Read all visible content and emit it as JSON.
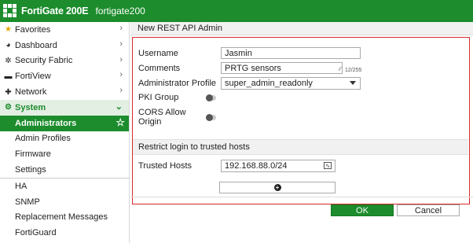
{
  "topbar": {
    "brand": "FortiGate 200E",
    "hostname": "fortigate200"
  },
  "sidebar": {
    "items": [
      {
        "label": "Favorites",
        "icon": "star-icon"
      },
      {
        "label": "Dashboard",
        "icon": "dashboard-icon"
      },
      {
        "label": "Security Fabric",
        "icon": "fabric-icon"
      },
      {
        "label": "FortiView",
        "icon": "fortiview-icon"
      },
      {
        "label": "Network",
        "icon": "network-icon"
      },
      {
        "label": "System",
        "icon": "gear-icon"
      }
    ],
    "system_children": [
      "Administrators",
      "Admin Profiles",
      "Firmware",
      "Settings",
      "HA",
      "SNMP",
      "Replacement Messages",
      "FortiGuard"
    ]
  },
  "main": {
    "header": "New REST API Admin",
    "fields": {
      "username_label": "Username",
      "username_value": "Jasmin",
      "comments_label": "Comments",
      "comments_value": "PRTG sensors",
      "comments_counter": "12/255",
      "profile_label": "Administrator Profile",
      "profile_value": "super_admin_readonly",
      "pki_label": "PKI Group",
      "cors_label": "CORS Allow Origin"
    },
    "restrict_section": "Restrict login to trusted hosts",
    "trusted_hosts_label": "Trusted Hosts",
    "trusted_hosts_value": "192.168.88.0/24",
    "ok_label": "OK",
    "cancel_label": "Cancel"
  },
  "colors": {
    "accent": "#1c8c2c",
    "highlight_border": "#d42a2a"
  }
}
